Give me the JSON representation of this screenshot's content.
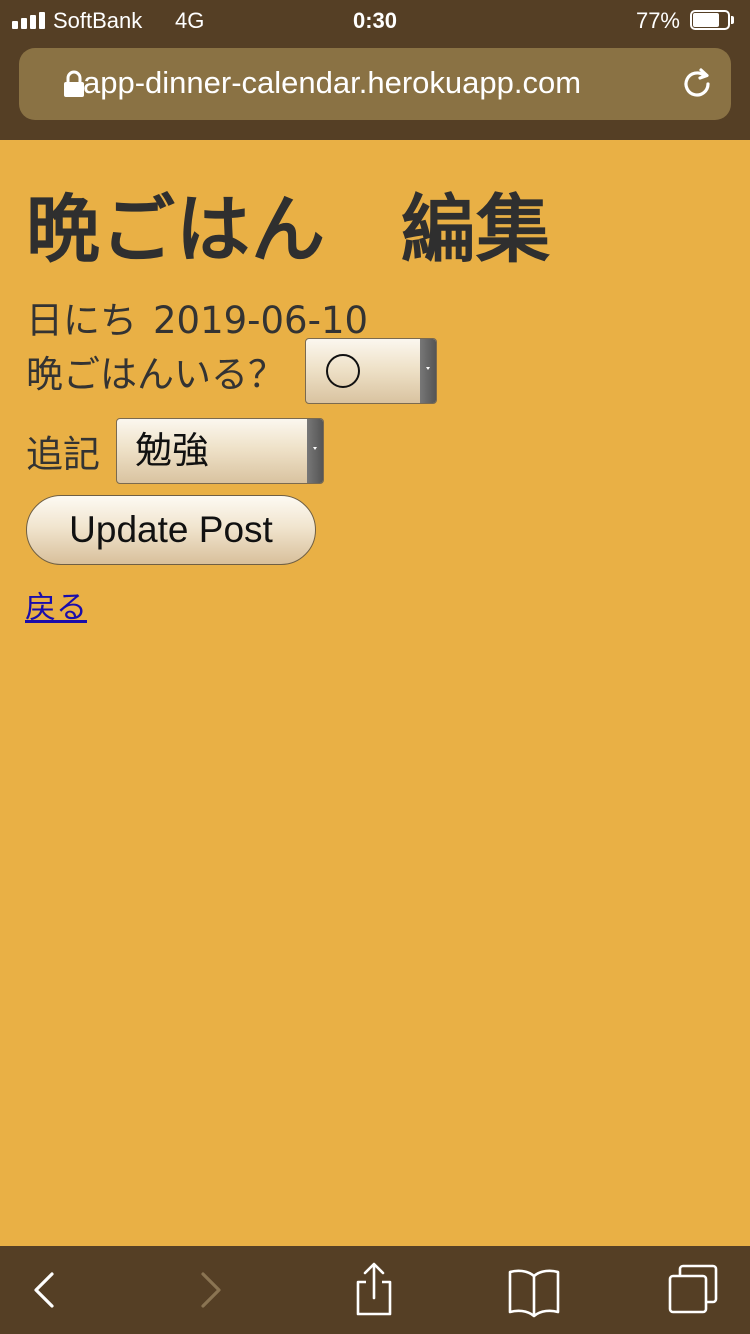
{
  "status_bar": {
    "carrier": "SoftBank",
    "network": "4G",
    "time": "0:30",
    "battery_percent_label": "77%",
    "battery_level": 0.77
  },
  "browser": {
    "url": "app-dinner-calendar.herokuapp.com"
  },
  "page": {
    "title": "晩ごはん　編集",
    "date_label": "日にち",
    "date_value": "2019-06-10",
    "dinner_label": "晩ごはんいる？",
    "dinner_selected": "◯",
    "note_label": "追記",
    "note_selected": "勉強",
    "update_button_label": "Update Post",
    "back_link_label": "戻る"
  },
  "colors": {
    "page_background": "#e9b045",
    "chrome_background": "#553f25",
    "url_bar_background": "#8a7244",
    "link_color": "#1a0dab"
  },
  "icons": {
    "lock": "lock-icon",
    "reload": "reload-icon",
    "back": "back-chevron-icon",
    "forward": "forward-chevron-icon",
    "share": "share-icon",
    "bookmarks": "bookmarks-book-icon",
    "tabs": "tabs-icon"
  }
}
